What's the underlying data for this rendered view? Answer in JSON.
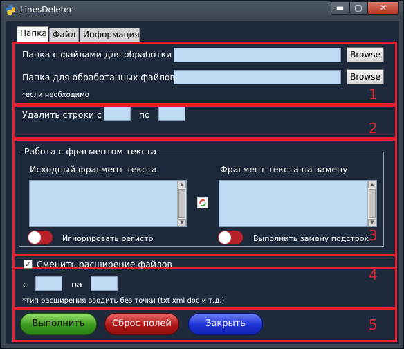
{
  "window": {
    "title": "LinesDeleter",
    "minimize_glyph": "▬",
    "maximize_glyph": "▢",
    "close_glyph": "✕"
  },
  "tabs": [
    {
      "label": "Папка"
    },
    {
      "label": "Файл"
    },
    {
      "label": "Информация"
    }
  ],
  "section1": {
    "number": "1",
    "source_label": "Папка с файлами для обработки",
    "source_value": "",
    "dest_label": "Папка для обработанных файлов",
    "dest_value": "",
    "browse_label": "Browse",
    "note": "*если необходимо"
  },
  "section2": {
    "number": "2",
    "delete_from_label": "Удалить строки с",
    "from_value": "",
    "to_label": "по",
    "to_value": ""
  },
  "section3": {
    "number": "3",
    "group_title": "Работа с фрагментом текста",
    "source_fragment_label": "Исходный фрагмент текста",
    "replace_fragment_label": "Фрагмент текста на замену",
    "ignore_case_label": "Игнорировать регистр",
    "replace_substrings_label": "Выполнить замену подстрок"
  },
  "section4": {
    "number": "4",
    "change_ext_label": "Сменить расширение файлов",
    "change_ext_checked": true,
    "from_label": "с",
    "to_label": "на",
    "note": "*тип расширения вводить без точки (txt xml doc и т.д.)"
  },
  "section5": {
    "number": "5",
    "run_label": "Выполнить",
    "reset_label": "Сброс полей",
    "close_label": "Закрыть"
  },
  "colors": {
    "highlight": "#e8202e",
    "background": "#1e2a3c",
    "field": "#c0dcf4"
  }
}
